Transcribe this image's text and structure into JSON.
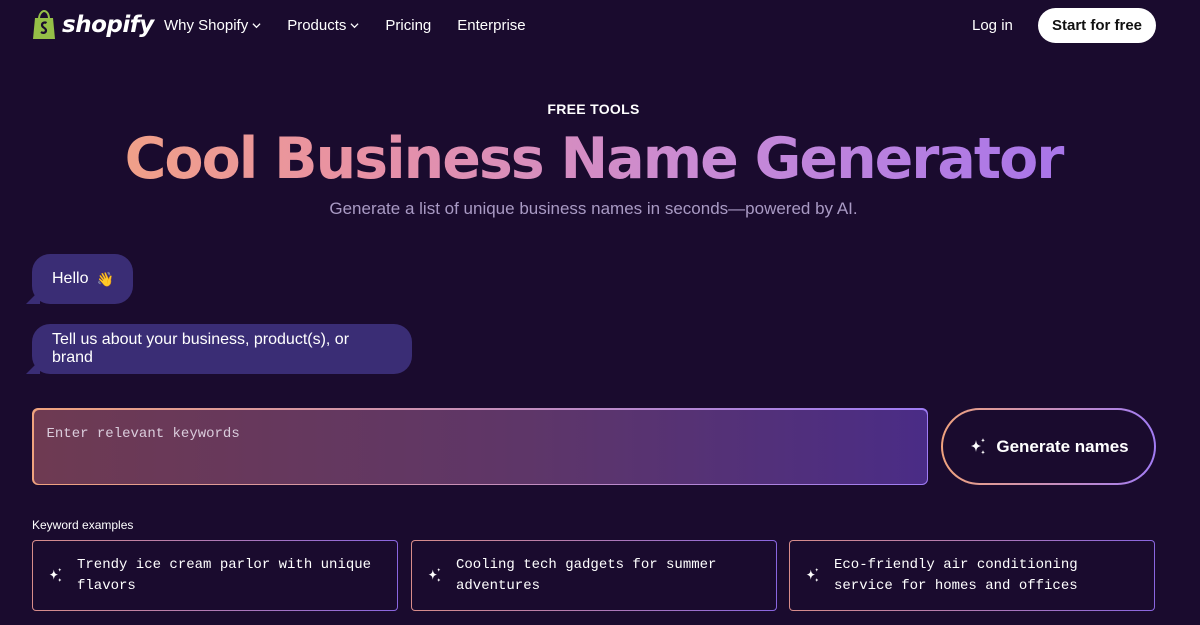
{
  "header": {
    "logo_text": "shopify",
    "nav": [
      {
        "label": "Why Shopify",
        "has_dropdown": true
      },
      {
        "label": "Products",
        "has_dropdown": true
      },
      {
        "label": "Pricing",
        "has_dropdown": false
      },
      {
        "label": "Enterprise",
        "has_dropdown": false
      }
    ],
    "login_label": "Log in",
    "start_label": "Start for free"
  },
  "hero": {
    "eyebrow": "FREE TOOLS",
    "title": "Cool Business Name Generator",
    "subtitle": "Generate a list of unique business names in seconds—powered by AI."
  },
  "chat": {
    "greeting": "Hello",
    "greeting_emoji": "👋",
    "prompt": "Tell us about your business, product(s), or brand"
  },
  "form": {
    "input_placeholder": "Enter relevant keywords",
    "input_value": "",
    "generate_label": "Generate names"
  },
  "examples": {
    "label": "Keyword examples",
    "items": [
      {
        "text": "Trendy ice cream parlor with unique flavors"
      },
      {
        "text": "Cooling tech gadgets for summer adventures"
      },
      {
        "text": "Eco-friendly air conditioning service for homes and offices"
      }
    ]
  },
  "colors": {
    "background": "#1a0b2e",
    "bubble": "#3a2d75",
    "gradient_start": "#f5a87a",
    "gradient_end": "#9d6ef0"
  },
  "icons": {
    "logo": "shopify-bag-icon",
    "dropdown": "chevron-down-icon",
    "sparkle": "sparkle-icon"
  }
}
